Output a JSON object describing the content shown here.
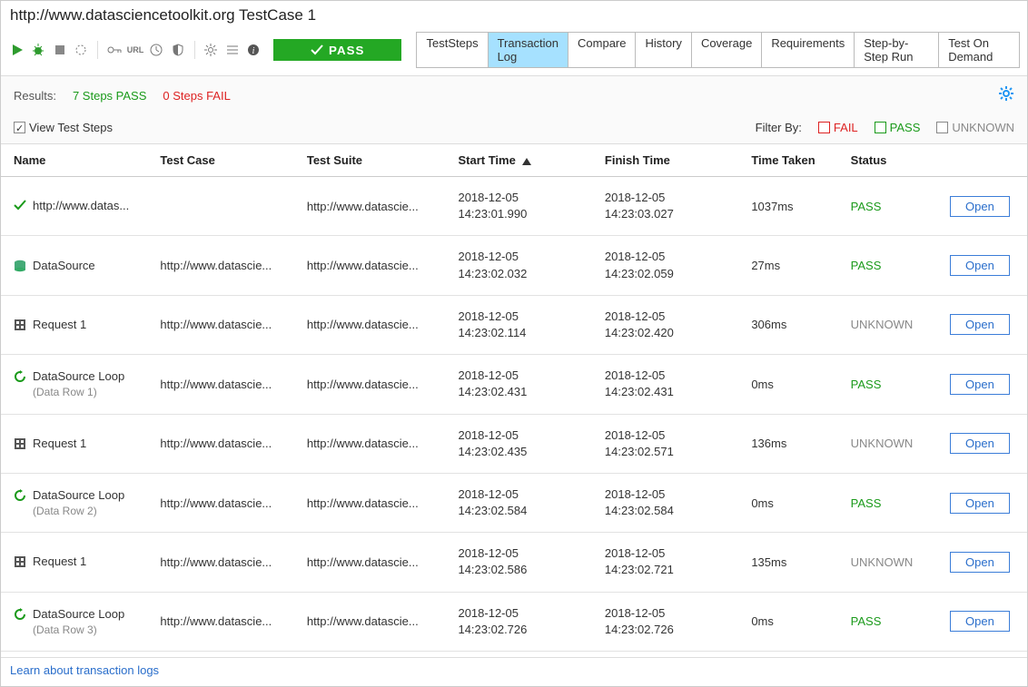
{
  "title": "http://www.datasciencetoolkit.org TestCase 1",
  "toolbar": {
    "pass_btn": "PASS"
  },
  "tabs": [
    "TestSteps",
    "Transaction Log",
    "Compare",
    "History",
    "Coverage",
    "Requirements",
    "Step-by-Step Run",
    "Test On Demand"
  ],
  "active_tab": 1,
  "results": {
    "label": "Results:",
    "pass": "7 Steps PASS",
    "fail": "0 Steps FAIL"
  },
  "view_steps": {
    "label": "View Test Steps",
    "checked": true
  },
  "filter": {
    "label": "Filter By:",
    "fail": "FAIL",
    "pass": "PASS",
    "unknown": "UNKNOWN"
  },
  "columns": [
    "Name",
    "Test Case",
    "Test Suite",
    "Start Time",
    "Finish Time",
    "Time Taken",
    "Status",
    ""
  ],
  "sort_col": 3,
  "open_label": "Open",
  "rows": [
    {
      "icon": "check",
      "name": "http://www.datas...",
      "sub": "",
      "tc": "",
      "ts": "http://www.datascie...",
      "start": "2018-12-05\n14:23:01.990",
      "finish": "2018-12-05\n14:23:03.027",
      "taken": "1037ms",
      "status": "PASS"
    },
    {
      "icon": "ds",
      "name": "DataSource",
      "sub": "",
      "tc": "http://www.datascie...",
      "ts": "http://www.datascie...",
      "start": "2018-12-05\n14:23:02.032",
      "finish": "2018-12-05\n14:23:02.059",
      "taken": "27ms",
      "status": "PASS"
    },
    {
      "icon": "req",
      "name": "Request 1",
      "sub": "",
      "tc": "http://www.datascie...",
      "ts": "http://www.datascie...",
      "start": "2018-12-05\n14:23:02.114",
      "finish": "2018-12-05\n14:23:02.420",
      "taken": "306ms",
      "status": "UNKNOWN"
    },
    {
      "icon": "loop",
      "name": "DataSource Loop",
      "sub": "(Data Row 1)",
      "tc": "http://www.datascie...",
      "ts": "http://www.datascie...",
      "start": "2018-12-05\n14:23:02.431",
      "finish": "2018-12-05\n14:23:02.431",
      "taken": "0ms",
      "status": "PASS"
    },
    {
      "icon": "req",
      "name": "Request 1",
      "sub": "",
      "tc": "http://www.datascie...",
      "ts": "http://www.datascie...",
      "start": "2018-12-05\n14:23:02.435",
      "finish": "2018-12-05\n14:23:02.571",
      "taken": "136ms",
      "status": "UNKNOWN"
    },
    {
      "icon": "loop",
      "name": "DataSource Loop",
      "sub": "(Data Row 2)",
      "tc": "http://www.datascie...",
      "ts": "http://www.datascie...",
      "start": "2018-12-05\n14:23:02.584",
      "finish": "2018-12-05\n14:23:02.584",
      "taken": "0ms",
      "status": "PASS"
    },
    {
      "icon": "req",
      "name": "Request 1",
      "sub": "",
      "tc": "http://www.datascie...",
      "ts": "http://www.datascie...",
      "start": "2018-12-05\n14:23:02.586",
      "finish": "2018-12-05\n14:23:02.721",
      "taken": "135ms",
      "status": "UNKNOWN"
    },
    {
      "icon": "loop",
      "name": "DataSource Loop",
      "sub": "(Data Row 3)",
      "tc": "http://www.datascie...",
      "ts": "http://www.datascie...",
      "start": "2018-12-05\n14:23:02.726",
      "finish": "2018-12-05\n14:23:02.726",
      "taken": "0ms",
      "status": "PASS"
    }
  ],
  "footer_link": "Learn about transaction logs"
}
